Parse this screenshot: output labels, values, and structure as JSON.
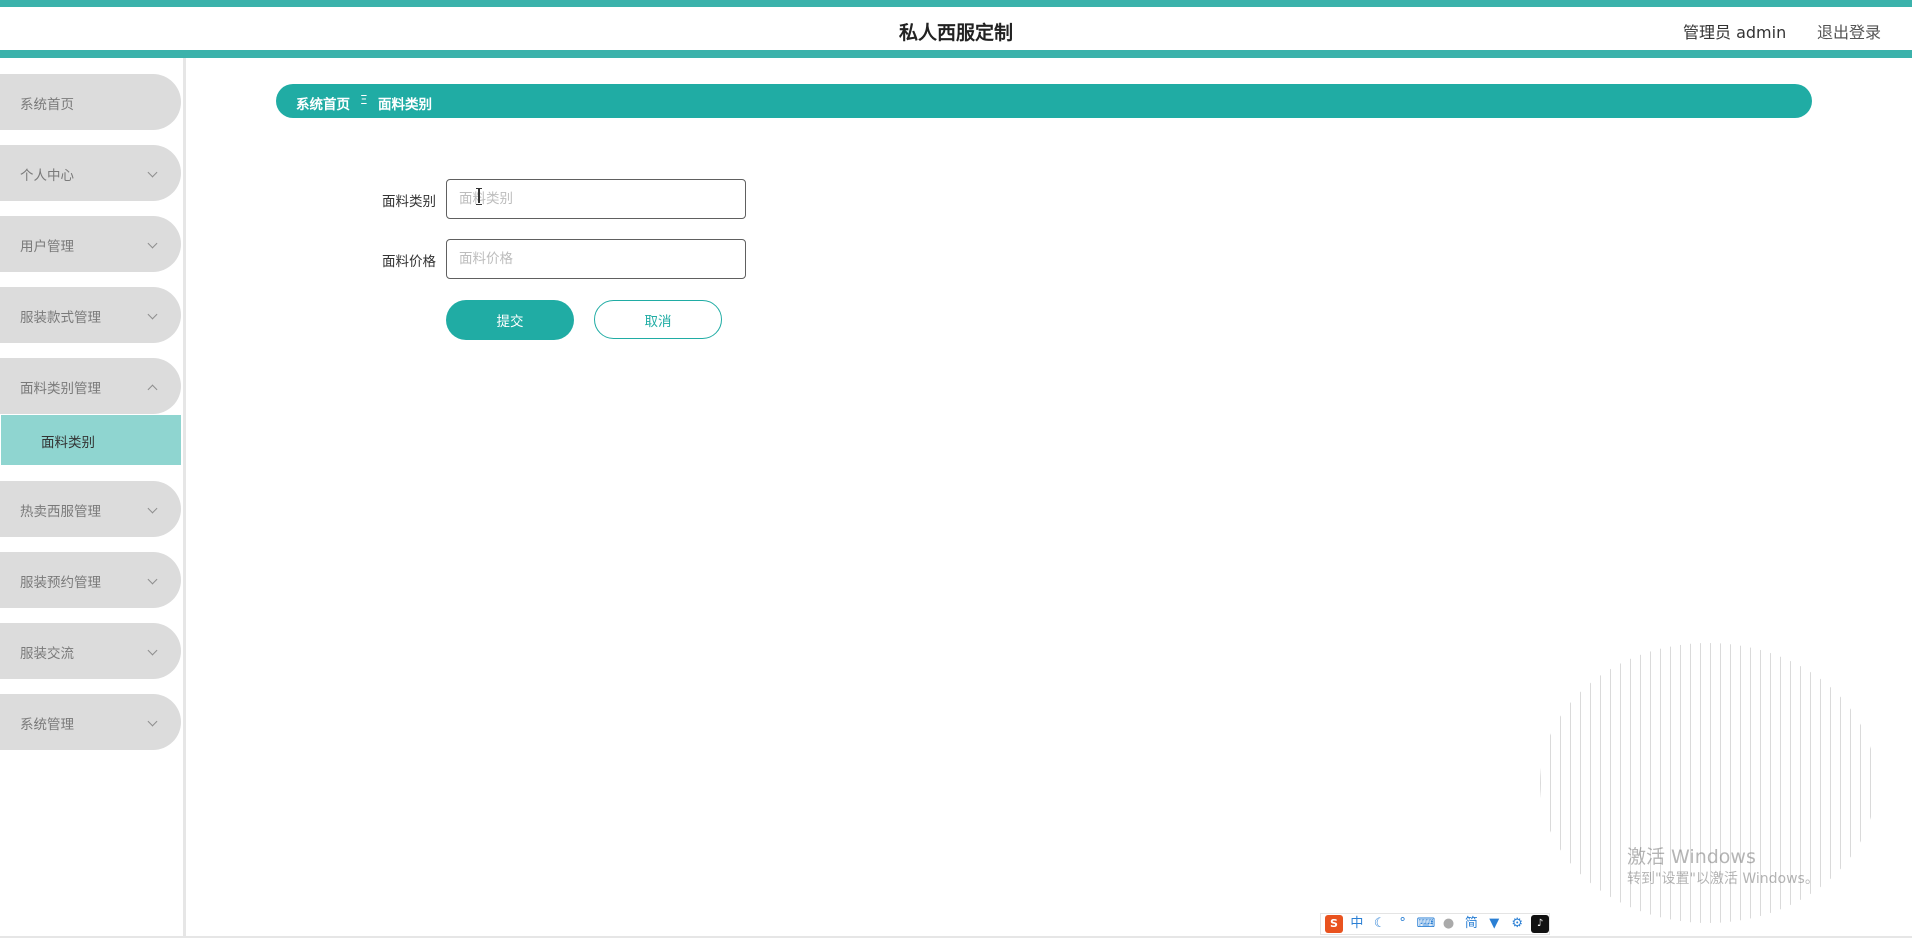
{
  "header": {
    "title": "私人西服定制",
    "admin_label": "管理员 admin",
    "logout": "退出登录"
  },
  "sidebar": {
    "items": [
      {
        "label": "系统首页"
      },
      {
        "label": "个人中心"
      },
      {
        "label": "用户管理"
      },
      {
        "label": "服装款式管理"
      },
      {
        "label": "面料类别管理"
      },
      {
        "label": "热卖西服管理"
      },
      {
        "label": "服装预约管理"
      },
      {
        "label": "服装交流"
      },
      {
        "label": "系统管理"
      }
    ],
    "submenu": {
      "label": "面料类别"
    }
  },
  "breadcrumb": {
    "home": "系统首页",
    "separator": "Ξ",
    "current": "面料类别"
  },
  "form": {
    "category_label": "面料类别",
    "category_placeholder": "面料类别",
    "category_value": "",
    "price_label": "面料价格",
    "price_placeholder": "面料价格",
    "price_value": "",
    "submit_label": "提交",
    "cancel_label": "取消"
  },
  "watermark": {
    "title": "激活 Windows",
    "subtitle": "转到\"设置\"以激活 Windows。"
  },
  "ime": {
    "mode": "中",
    "simplified": "简"
  },
  "colors": {
    "accent": "#20aca4",
    "header_stripe": "#3bb2ab",
    "submenu_active": "#8fd5d0",
    "menu_bg": "#dcdcdc"
  }
}
